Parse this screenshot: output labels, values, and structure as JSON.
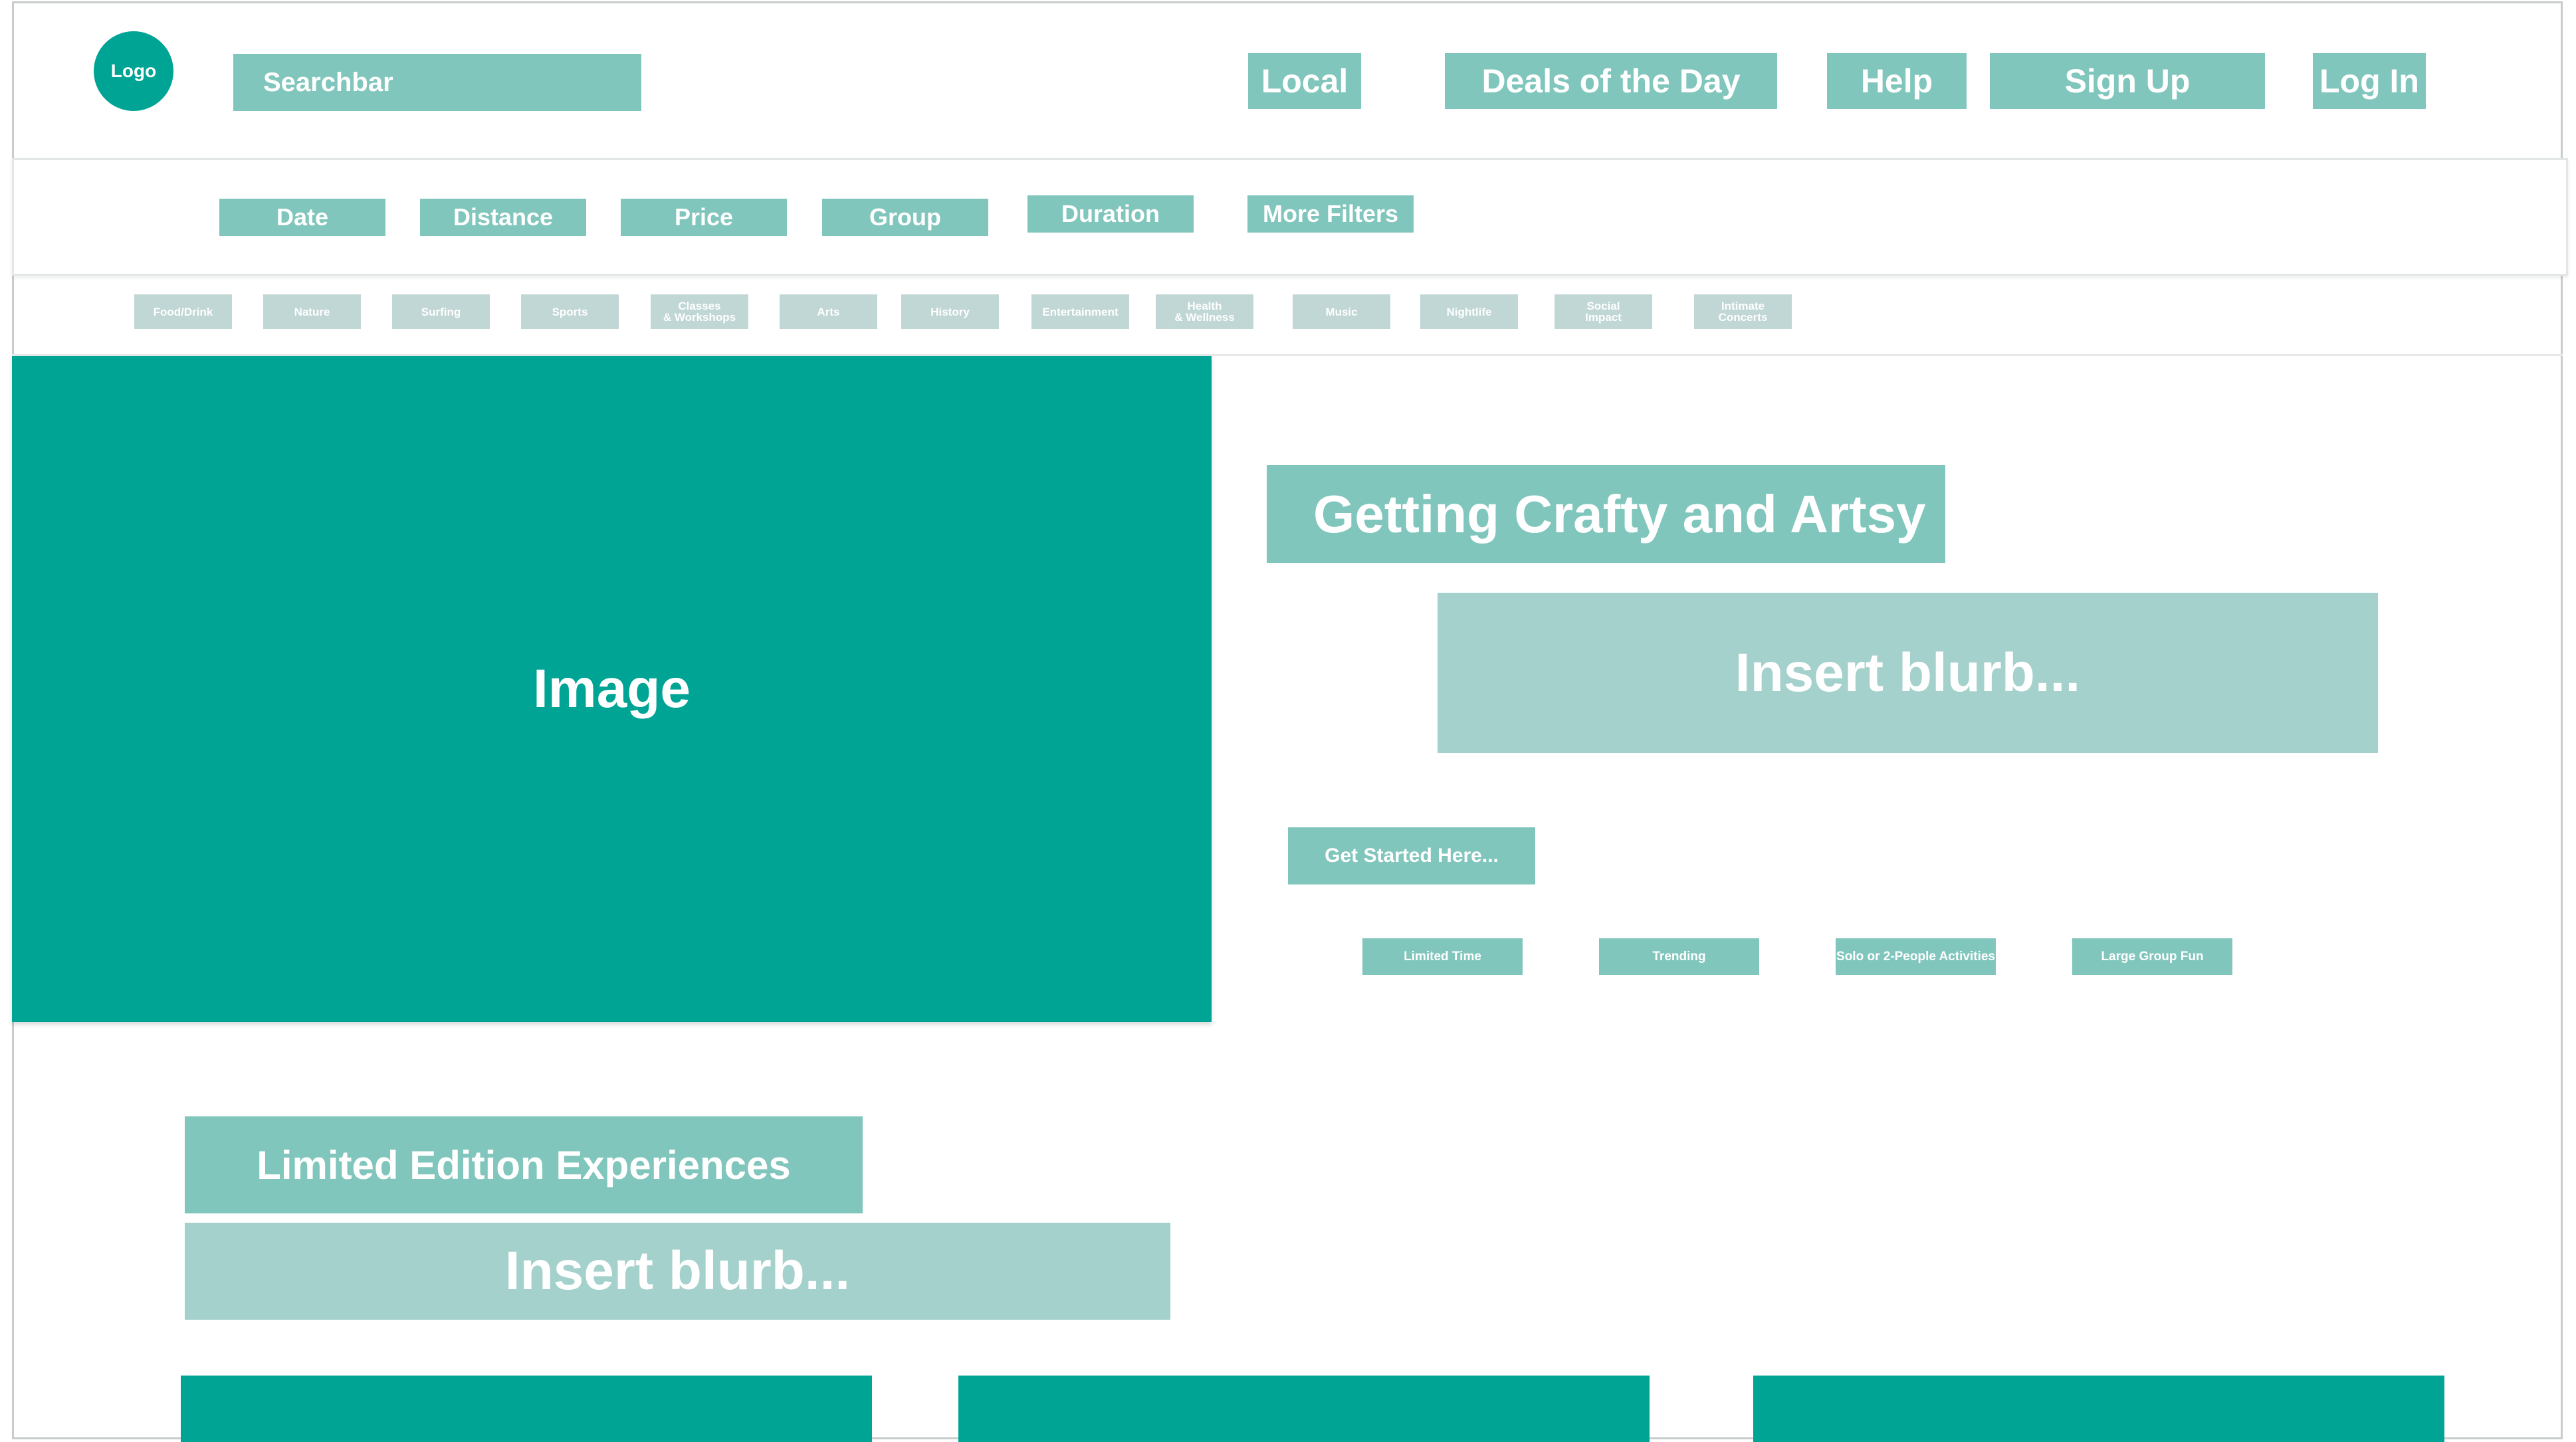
{
  "header": {
    "logo": "Logo",
    "search_label": "Searchbar",
    "nav": [
      "Local",
      "Deals of the Day",
      "Help",
      "Sign Up",
      "Log In"
    ]
  },
  "filters": [
    "Date",
    "Distance",
    "Price",
    "Group",
    "Duration",
    "More Filters"
  ],
  "categories": [
    "Food/Drink",
    "Nature",
    "Surfing",
    "Sports",
    "Classes\n& Workshops",
    "Arts",
    "History",
    "Entertainment",
    "Health\n& Wellness",
    "Music",
    "Nightlife",
    "Social\nImpact",
    "Intimate\nConcerts"
  ],
  "hero": {
    "image_label": "Image",
    "title": "Getting Crafty and Artsy",
    "blurb": "Insert blurb...",
    "cta": "Get Started Here...",
    "tags": [
      "Limited Time",
      "Trending",
      "Solo or 2-People Activities",
      "Large Group Fun"
    ]
  },
  "limited": {
    "title": "Limited Edition Experiences",
    "blurb": "Insert blurb..."
  },
  "colors": {
    "primary_teal": "#00a495",
    "button_teal": "#80c6bc",
    "pale_teal": "#a5d1cc",
    "chip_gray": "#c1d7d5"
  }
}
